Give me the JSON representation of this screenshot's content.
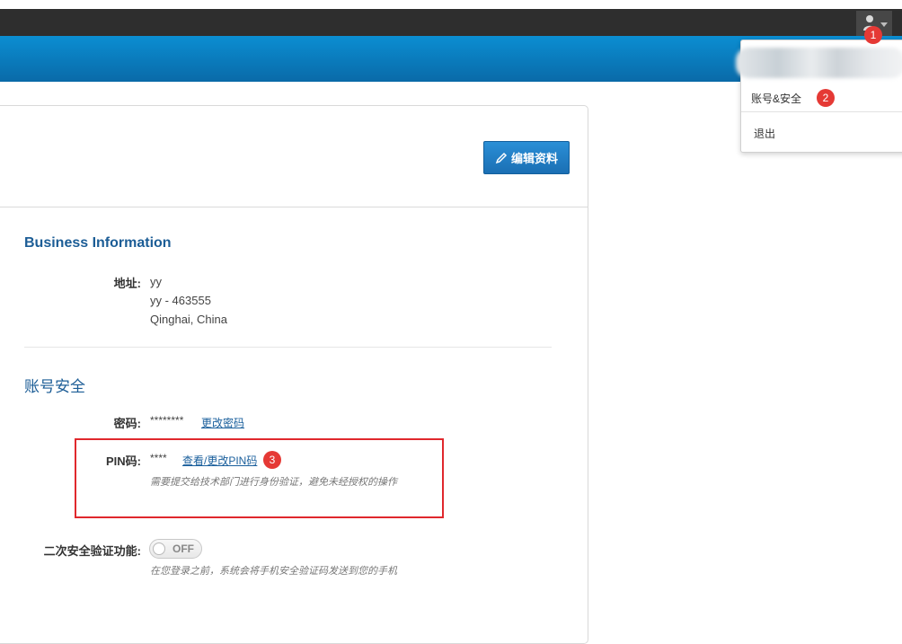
{
  "header": {
    "user_menu": {
      "icon": "user-icon",
      "caret_icon": "chevron-down-icon"
    },
    "dropdown": {
      "items": [
        {
          "label": "账号&安全"
        },
        {
          "label": "退出"
        }
      ]
    }
  },
  "annotations": {
    "badges": [
      "1",
      "2",
      "3"
    ],
    "highlight_color": "#e0282d"
  },
  "toolbar": {
    "edit_label": "编辑资料",
    "edit_icon": "pencil-icon"
  },
  "business": {
    "title": "Business Information",
    "address_label": "地址:",
    "address_lines": [
      "yy",
      "yy - 463555",
      "Qinghai, China"
    ]
  },
  "security": {
    "title": "账号安全",
    "password_label": "密码:",
    "password_value": "********",
    "password_link": "更改密码",
    "pin_label": "PIN码:",
    "pin_value": "****",
    "pin_link": "查看/更改PIN码",
    "pin_hint": "需要提交给技术部门进行身份验证，避免未经授权的操作",
    "twofa_label": "二次安全验证功能:",
    "twofa_toggle": "OFF",
    "twofa_hint": "在您登录之前，系统会将手机安全验证码发送到您的手机"
  },
  "colors": {
    "accent": "#0b8ed2",
    "title": "#1c5d96",
    "badge": "#e53935"
  }
}
